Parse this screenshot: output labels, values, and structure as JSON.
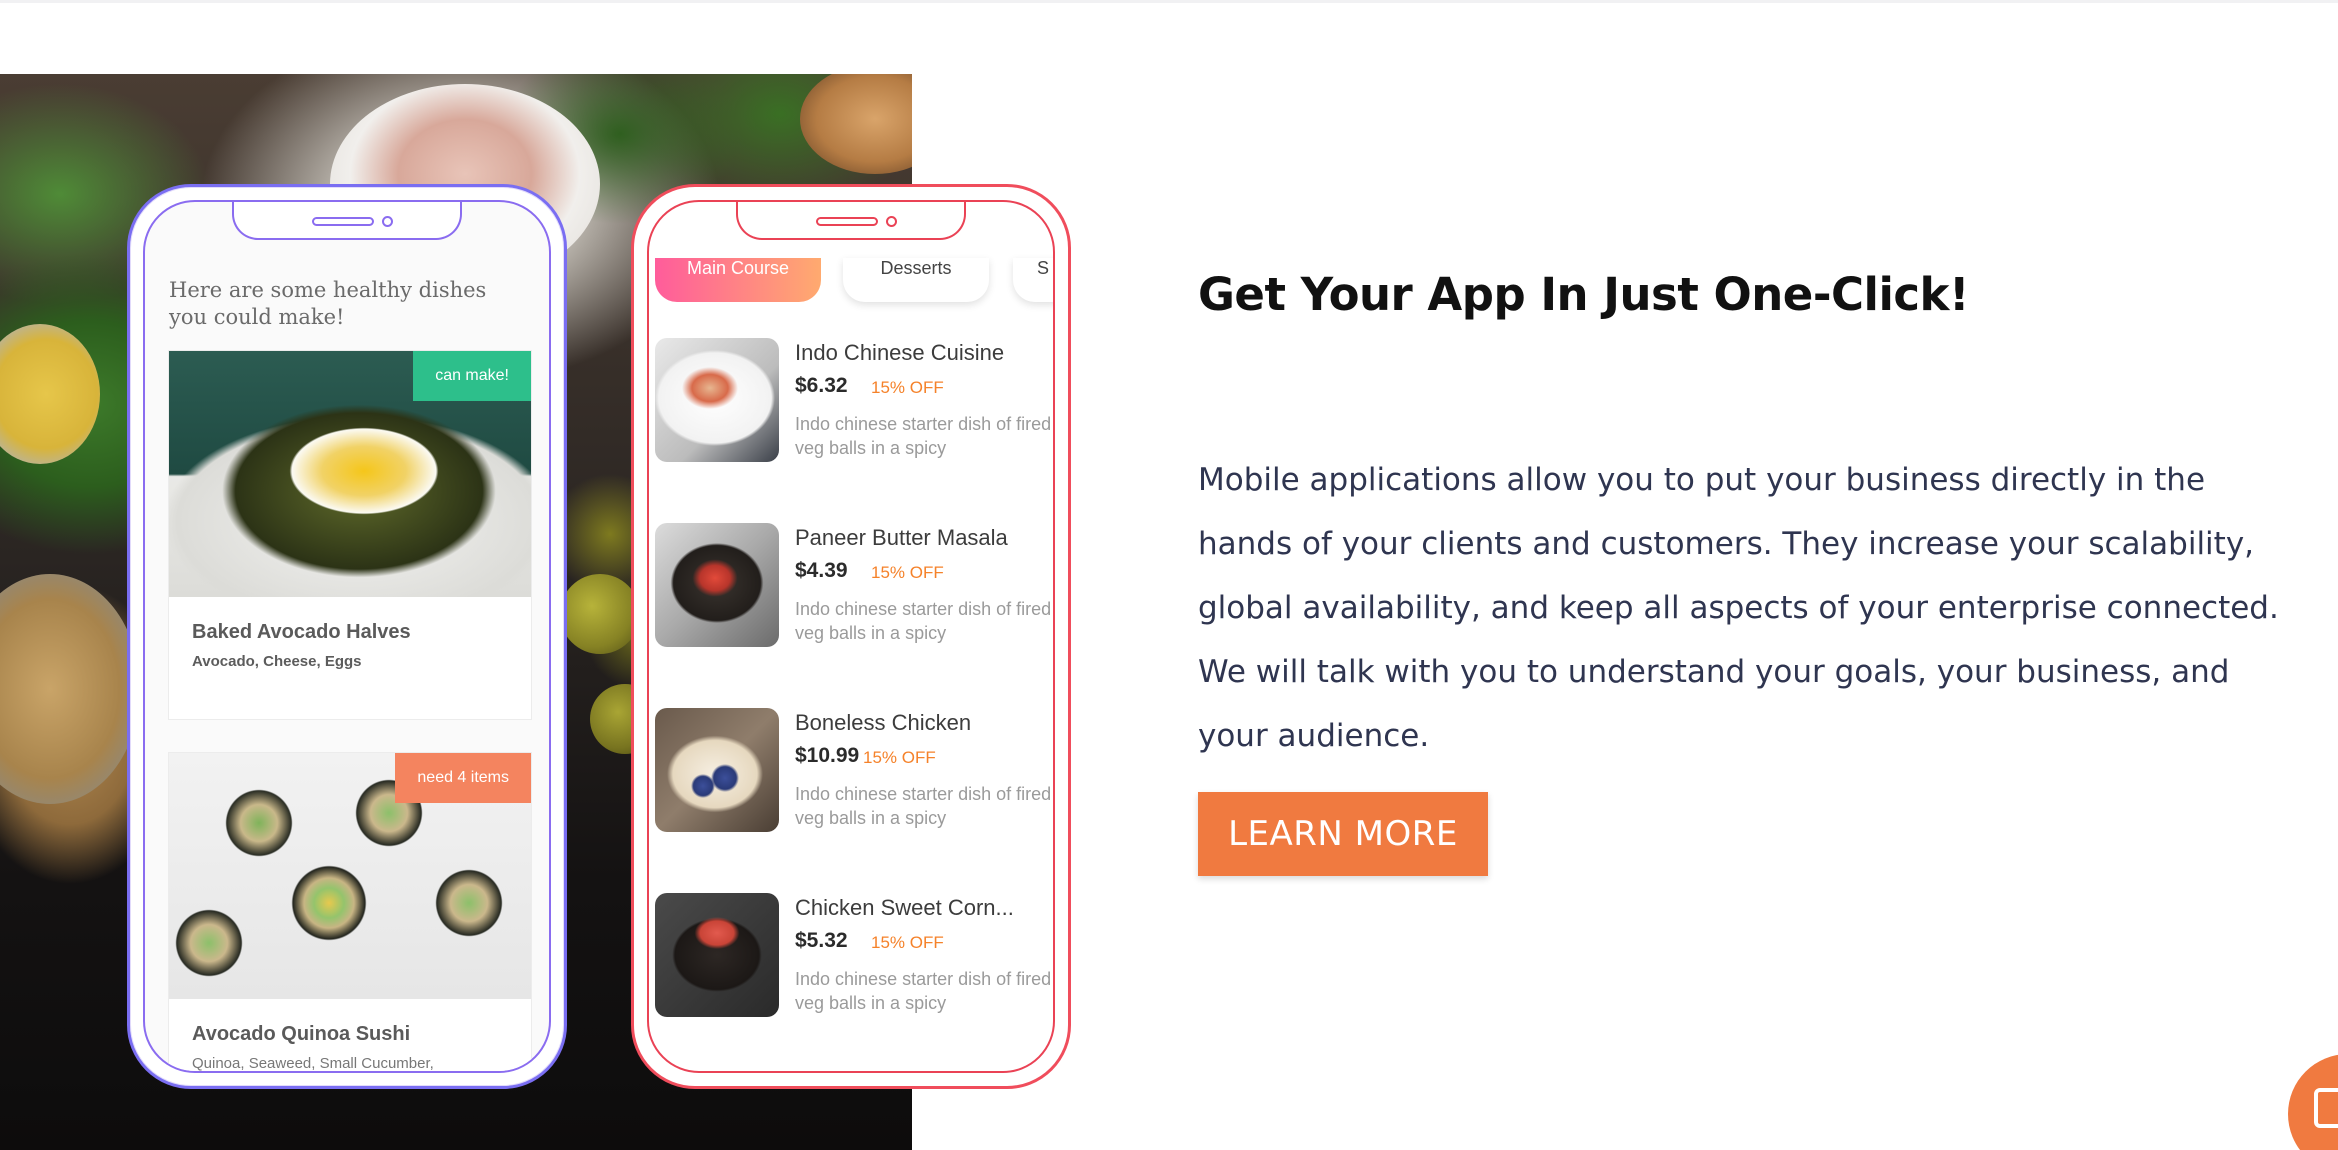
{
  "left_phone": {
    "heading": "Here are some healthy dishes you could make!",
    "dishes": [
      {
        "title": "Baked Avocado Halves",
        "ingredients": "Avocado, Cheese, Eggs",
        "badge": "can make!",
        "badge_color": "#2dbf8b"
      },
      {
        "title": "Avocado Quinoa Sushi",
        "ingredients": "Quinoa, Seaweed, Small Cucumber,",
        "badge": "need 4 items",
        "badge_color": "#f4845f"
      }
    ]
  },
  "right_phone": {
    "tabs": [
      "Main Course",
      "Desserts",
      "S"
    ],
    "menu": [
      {
        "name": "Indo Chinese Cuisine",
        "price": "$6.32",
        "discount": "15% OFF",
        "desc": "Indo chinese starter dish of fired veg balls in a spicy"
      },
      {
        "name": "Paneer Butter Masala",
        "price": "$4.39",
        "discount": "15% OFF",
        "desc": "Indo chinese starter dish of fired veg balls in a spicy"
      },
      {
        "name": "Boneless Chicken",
        "price": "$10.99",
        "discount": "15% OFF",
        "desc": "Indo chinese starter dish of fired veg balls in a spicy"
      },
      {
        "name": "Chicken Sweet Corn...",
        "price": "$5.32",
        "discount": "15% OFF",
        "desc": "Indo chinese starter dish of fired veg balls in a spicy"
      }
    ]
  },
  "content": {
    "headline": "Get Your App In Just One-Click!",
    "body": "Mobile applications allow you to put your business directly in the hands of your clients and customers. They increase your scalability, global availability, and keep all aspects of your enterprise connected. We will talk with you to understand your goals, your business, and your audience.",
    "cta_label": "LEARN MORE"
  },
  "colors": {
    "accent": "#f07a40",
    "left_phone_frame": "#7a6ef2",
    "right_phone_frame": "#f04d5c",
    "discount": "#f5822a"
  },
  "icons": [
    "chat-icon"
  ]
}
